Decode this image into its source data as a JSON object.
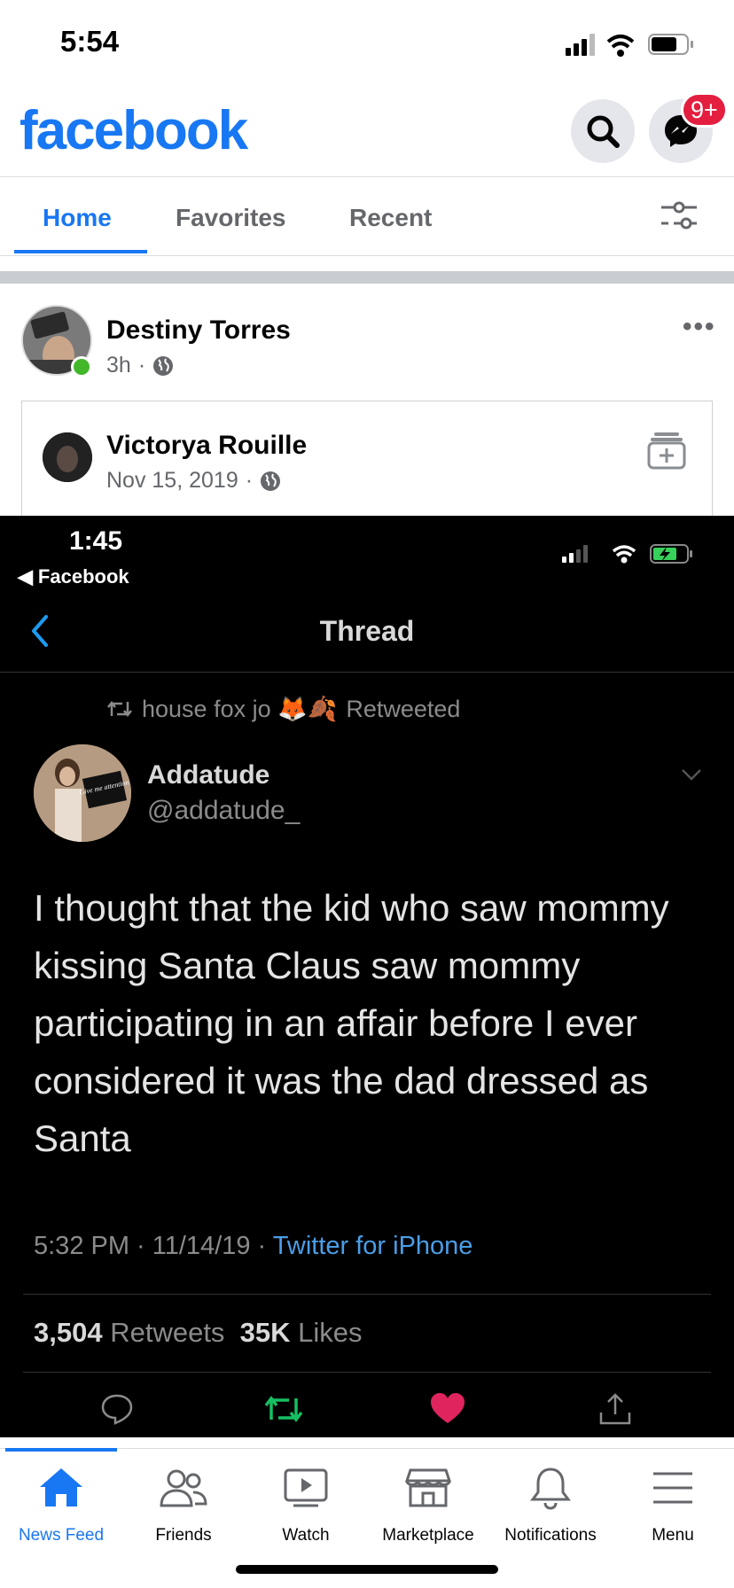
{
  "status_bar": {
    "time": "5:54"
  },
  "header": {
    "logo": "facebook",
    "messenger_badge": "9+"
  },
  "tabs": [
    {
      "label": "Home",
      "active": true
    },
    {
      "label": "Favorites",
      "active": false
    },
    {
      "label": "Recent",
      "active": false
    }
  ],
  "post": {
    "author": "Destiny Torres",
    "time": "3h",
    "privacy_icon": "globe-icon",
    "shared": {
      "author": "Victorya Rouille",
      "date": "Nov 15, 2019",
      "privacy_icon": "globe-icon"
    }
  },
  "screenshot": {
    "time": "1:45",
    "back_app": "Facebook",
    "title": "Thread",
    "retweet_by": "house fox jo 🦊🍂",
    "retweet_label": "Retweeted",
    "name": "Addatude",
    "handle": "@addatude_",
    "avatar_sign": "Give me attention",
    "text": "I thought that the kid who saw mommy kissing Santa Claus saw mommy participating in an affair before I ever considered it was the dad dressed as Santa",
    "time_posted": "5:32 PM · 11/14/19 · ",
    "source": "Twitter for iPhone",
    "retweets_count": "3,504",
    "retweets_label": "Retweets",
    "likes_count": "35K",
    "likes_label": "Likes"
  },
  "bottom_nav": [
    {
      "label": "News Feed",
      "icon": "home-icon",
      "active": true
    },
    {
      "label": "Friends",
      "icon": "friends-icon",
      "active": false
    },
    {
      "label": "Watch",
      "icon": "watch-icon",
      "active": false
    },
    {
      "label": "Marketplace",
      "icon": "marketplace-icon",
      "active": false
    },
    {
      "label": "Notifications",
      "icon": "bell-icon",
      "active": false
    },
    {
      "label": "Menu",
      "icon": "menu-icon",
      "active": false
    }
  ],
  "colors": {
    "brand": "#1877f2",
    "badge": "#e41e3f",
    "online": "#42b72a",
    "retweet_green": "#17bf63",
    "like_red": "#e0245e"
  }
}
